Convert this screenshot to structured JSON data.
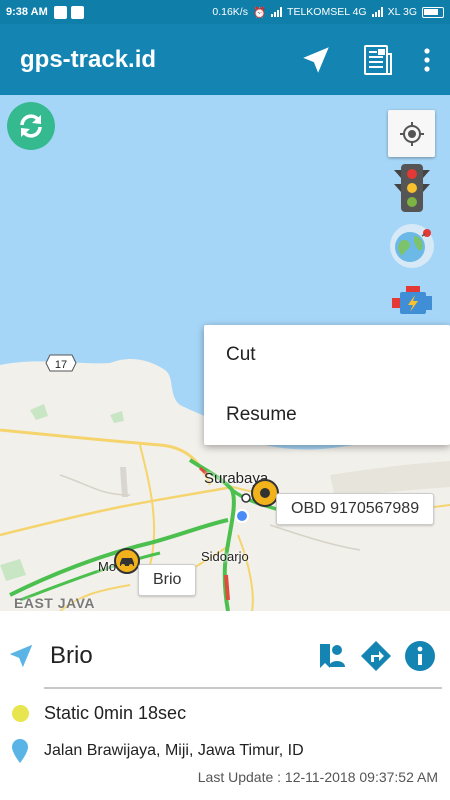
{
  "status_bar": {
    "time": "9:38 AM",
    "speed": "0.16K/s",
    "carrier1": "TELKOMSEL 4G",
    "carrier2": "XL 3G"
  },
  "app_bar": {
    "title": "gps-track.id",
    "icons": [
      "navigation-icon",
      "report-icon",
      "more-vert-icon"
    ]
  },
  "map": {
    "icons": [
      "refresh-icon",
      "my-location-icon",
      "traffic-light-icon",
      "globe-icon",
      "engine-icon"
    ],
    "popup_menu": {
      "items": [
        "Cut",
        "Resume"
      ]
    },
    "labels": {
      "city_main": "Surabaya",
      "city_small": "Sidoarjo",
      "city_partial": "Mo",
      "region": "EAST JAVA",
      "road_shield": "17"
    },
    "vehicles": [
      {
        "label": "OBD 9170567989"
      },
      {
        "label": "Brio"
      }
    ],
    "colors": {
      "water": "#a6d6f7",
      "land": "#f2f0ea",
      "road": "#f5d46e",
      "traffic_green": "#4cc04f",
      "traffic_red": "#e14b3b"
    }
  },
  "panel": {
    "vehicle_name": "Brio",
    "action_icons": [
      "person-pin-icon",
      "directions-icon",
      "info-icon"
    ],
    "status": "Static 0min 18sec",
    "address": "Jalan Brawijaya, Miji, Jawa Timur, ID",
    "last_update": "Last Update : 12-11-2018 09:37:52 AM",
    "colors": {
      "accent": "#1484b3",
      "status_dot": "#e8e650",
      "pin": "#5ab4e5"
    }
  }
}
